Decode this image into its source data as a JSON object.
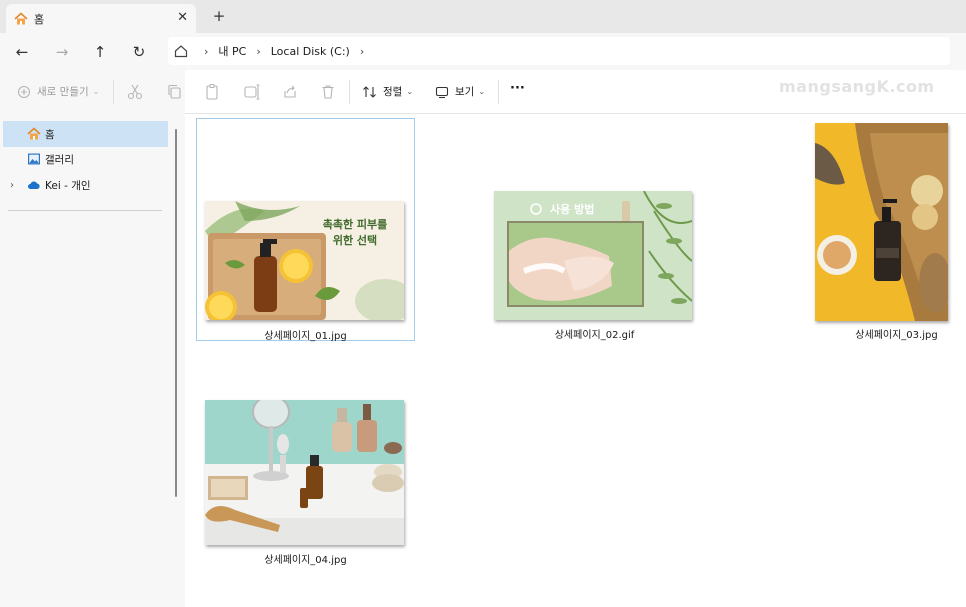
{
  "window": {
    "tab_title": "홈",
    "tab_close": "✕",
    "new_tab": "+"
  },
  "nav": {
    "back": "←",
    "forward": "→",
    "up": "↑",
    "refresh": "↻"
  },
  "breadcrumb": {
    "items": [
      "내 PC",
      "Local Disk (C:)"
    ],
    "separator": "›"
  },
  "toolbar": {
    "new_label": "새로 만들기",
    "sort_label": "정렬",
    "view_label": "보기",
    "more_label": "···"
  },
  "sidebar": {
    "items": [
      {
        "label": "홈",
        "icon": "home-icon",
        "selected": true
      },
      {
        "label": "갤러리",
        "icon": "gallery-icon",
        "selected": false
      },
      {
        "label": "Kei - 개인",
        "icon": "onedrive-cloud-icon",
        "selected": false
      }
    ]
  },
  "files": [
    {
      "name": "상세페이지_01.jpg",
      "selected": true,
      "thumb_text": "촉촉한 피부를\n위한 선택"
    },
    {
      "name": "상세페이지_02.gif",
      "selected": false,
      "thumb_text": "사용 방법"
    },
    {
      "name": "상세페이지_03.jpg",
      "selected": false,
      "thumb_text": ""
    },
    {
      "name": "상세페이지_04.jpg",
      "selected": false,
      "thumb_text": ""
    }
  ],
  "watermark": "mangsangK.com",
  "colors": {
    "accent": "#cde3f5",
    "selection_border": "#a6cbe8",
    "thumb1_text": "#3f6b2c",
    "thumb3_bg": "#f1b92a",
    "thumb4_wall": "#9fd6cc"
  }
}
